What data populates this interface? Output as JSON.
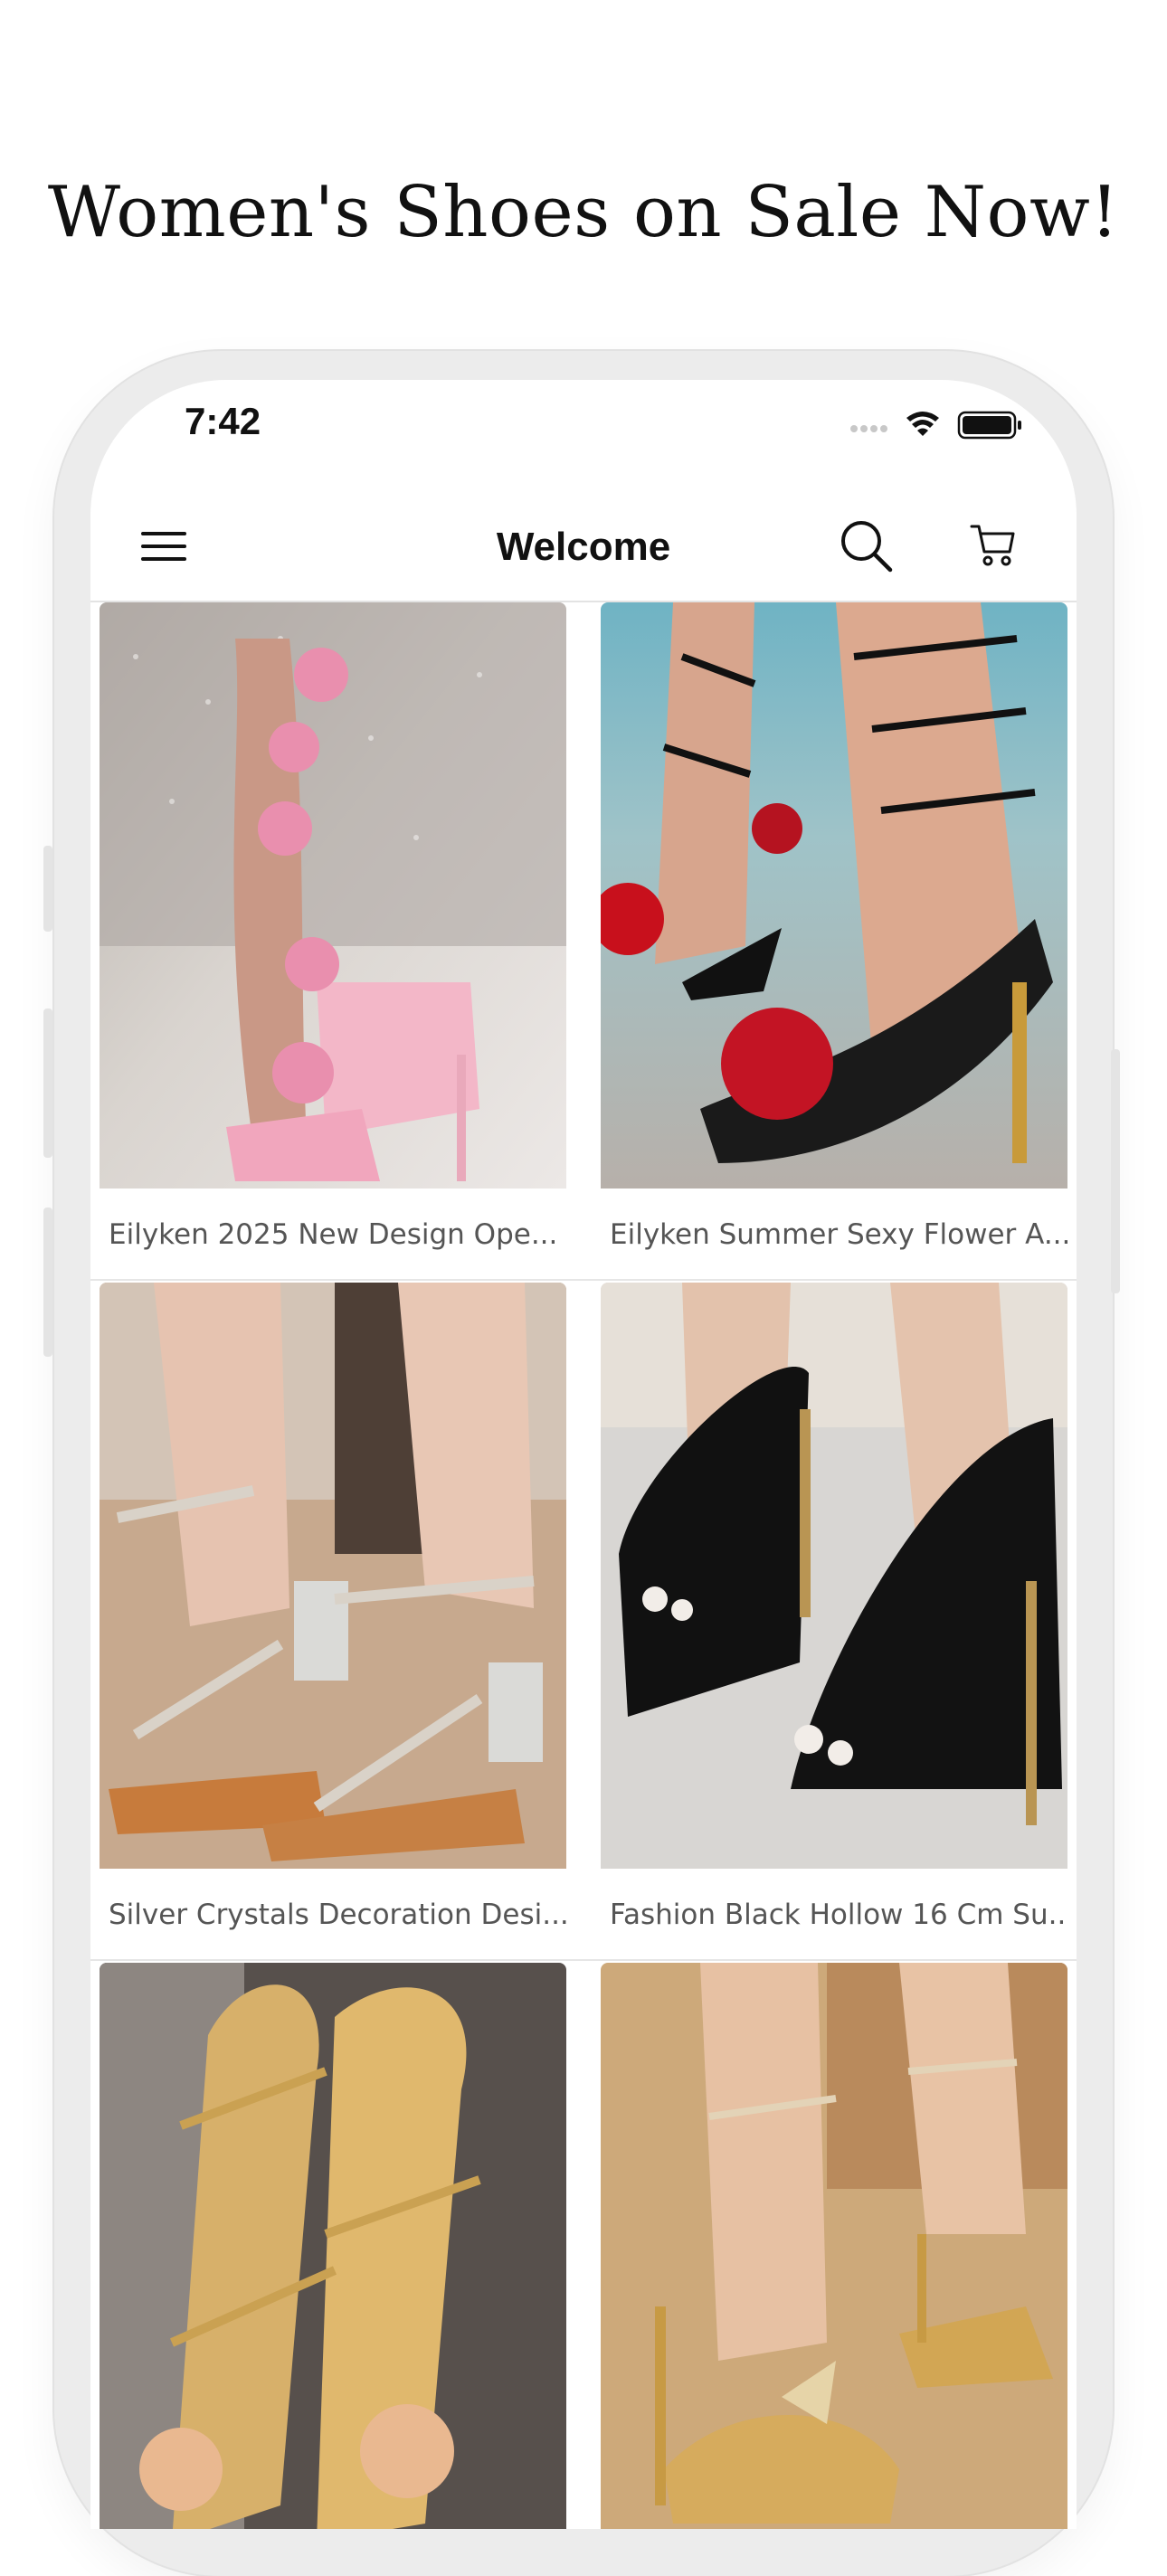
{
  "promo": {
    "headline": "Women's Shoes on Sale Now!"
  },
  "status_bar": {
    "time": "7:42"
  },
  "navbar": {
    "title": "Welcome",
    "icons": {
      "menu": "hamburger-menu-icon",
      "search": "search-icon",
      "cart": "cart-icon"
    }
  },
  "products": [
    {
      "title": "Eilyken 2025 New Design Ope...",
      "image": "pink-flower-wrap-heels"
    },
    {
      "title": "Eilyken Summer Sexy Flower A...",
      "image": "black-lace-up-red-flower-heels"
    },
    {
      "title": "Silver Crystals Decoration Desi...",
      "image": "silver-crystal-clear-heels"
    },
    {
      "title": "Fashion Black Hollow 16 Cm Su...",
      "image": "black-strappy-platform-heels"
    },
    {
      "title": "",
      "image": "gold-flower-strappy-heels"
    },
    {
      "title": "",
      "image": "gold-butterfly-ankle-strap-heels"
    }
  ],
  "colors": {
    "text": "#111111",
    "caption": "#555555",
    "divider": "#e3e3e3"
  }
}
